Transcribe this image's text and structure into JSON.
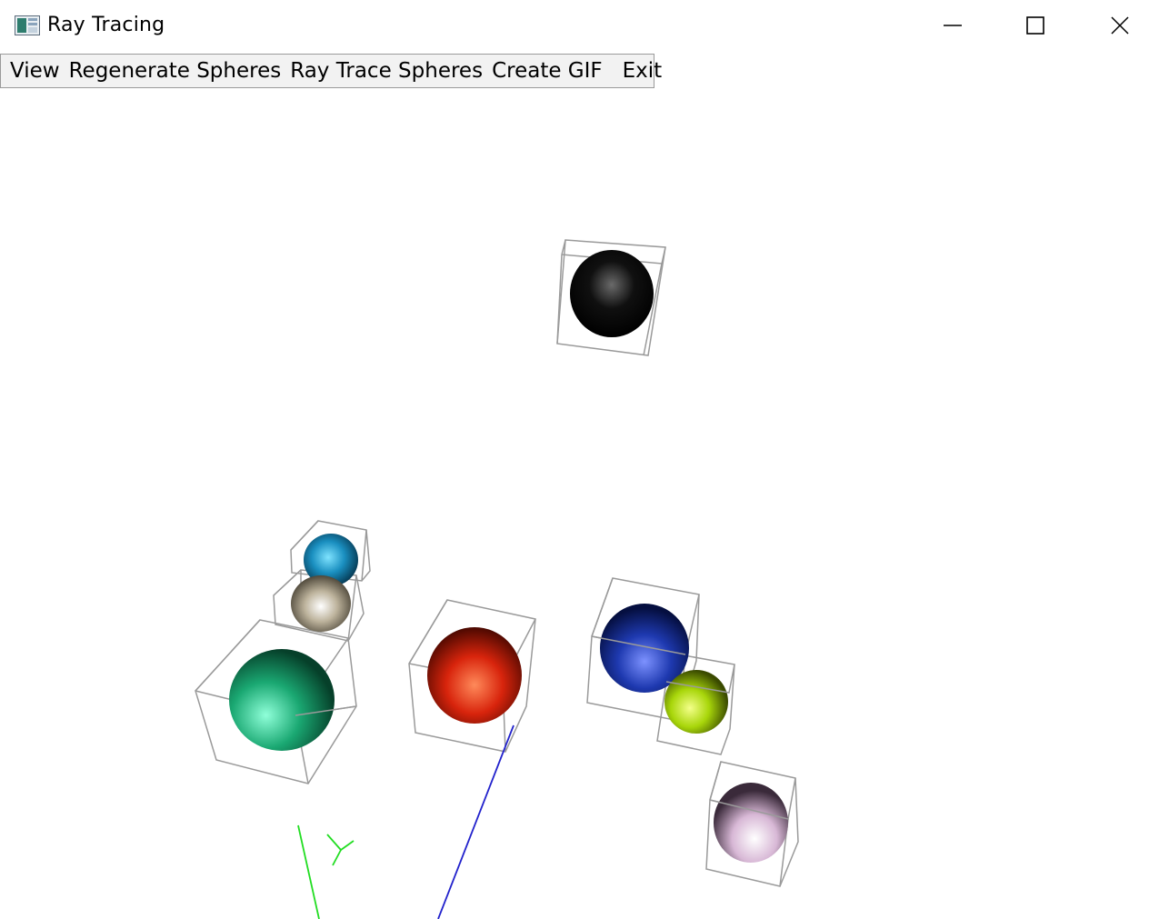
{
  "window": {
    "title": "Ray Tracing",
    "controls": {
      "minimize": "minimize-icon",
      "maximize": "maximize-icon",
      "close": "close-icon"
    }
  },
  "menu": {
    "items": [
      {
        "label": "View"
      },
      {
        "label": "Regenerate Spheres"
      },
      {
        "label": "Ray Trace Spheres"
      },
      {
        "label": "Create GIF"
      },
      {
        "label": "Exit"
      }
    ]
  },
  "scene": {
    "spheres": [
      {
        "color": "#101010",
        "highlight": "#6a6a6a"
      },
      {
        "color": "#1a8fc0",
        "highlight": "#7fe3ff"
      },
      {
        "color": "#bdb39c",
        "highlight": "#ffffff"
      },
      {
        "color": "#1aa872",
        "highlight": "#8fffd9"
      },
      {
        "color": "#d8240c",
        "highlight": "#ff8a5a"
      },
      {
        "color": "#1e39b0",
        "highlight": "#7d92ff"
      },
      {
        "color": "#a8d60a",
        "highlight": "#f4ff8a"
      },
      {
        "color": "#d8b8d6",
        "highlight": "#ffffff"
      }
    ],
    "axis_colors": {
      "x": "#2222cc",
      "y": "#22dd22"
    },
    "bounding_box_color": "#9a9a9a"
  }
}
